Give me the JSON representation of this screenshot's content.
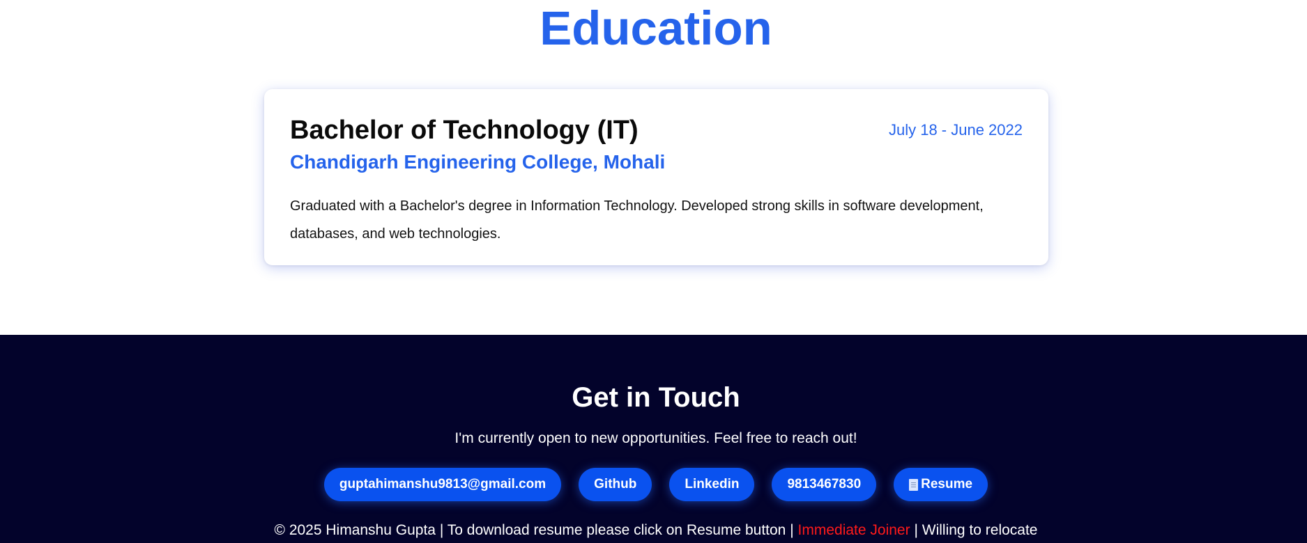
{
  "education": {
    "title": "Education",
    "entries": [
      {
        "degree": "Bachelor of Technology (IT)",
        "dates": "July 18 - June 2022",
        "institution": "Chandigarh Engineering College, Mohali",
        "description": "Graduated with a Bachelor's degree in Information Technology. Developed strong skills in software development, databases, and web technologies."
      }
    ]
  },
  "footer": {
    "title": "Get in Touch",
    "subtitle": "I'm currently open to new opportunities. Feel free to reach out!",
    "links": {
      "email": "guptahimanshu9813@gmail.com",
      "github": "Github",
      "linkedin": "Linkedin",
      "phone": "9813467830",
      "resume": "Resume",
      "resume_icon": "document-icon"
    },
    "copyright": {
      "main": "© 2025 Himanshu Gupta",
      "separator": "|",
      "download_note": "To download resume please click on Resume button",
      "highlight": "Immediate Joiner",
      "relocate": "Willing to relocate"
    }
  },
  "colors": {
    "accent": "#2563eb",
    "button": "#0a52ef",
    "footer_bg": "#03032b",
    "highlight": "#ff1a1a"
  }
}
